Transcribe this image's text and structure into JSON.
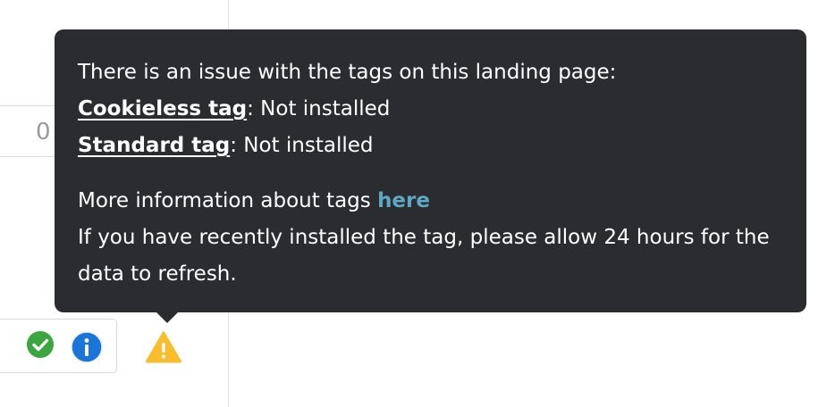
{
  "input": {
    "value": "0"
  },
  "status_icons": [
    {
      "name": "check-circle-icon",
      "color": "#3aa640"
    },
    {
      "name": "info-icon",
      "color": "#1b74d9"
    },
    {
      "name": "warning-icon",
      "color": "#f7bd2d"
    }
  ],
  "tooltip": {
    "heading": "There is an issue with the tags on this landing page:",
    "tags": [
      {
        "name": "Cookieless tag",
        "separator": ":",
        "status": " Not installed"
      },
      {
        "name": "Standard tag",
        "separator": ":",
        "status": " Not installed"
      }
    ],
    "more_info_text": "More information about tags ",
    "more_info_link": "here",
    "refresh_note_line1": "If you have recently installed the tag, please allow 24 hours for the",
    "refresh_note_line2": "data to refresh.",
    "background_color": "#2a2c30",
    "link_color": "#5fa8c4"
  }
}
